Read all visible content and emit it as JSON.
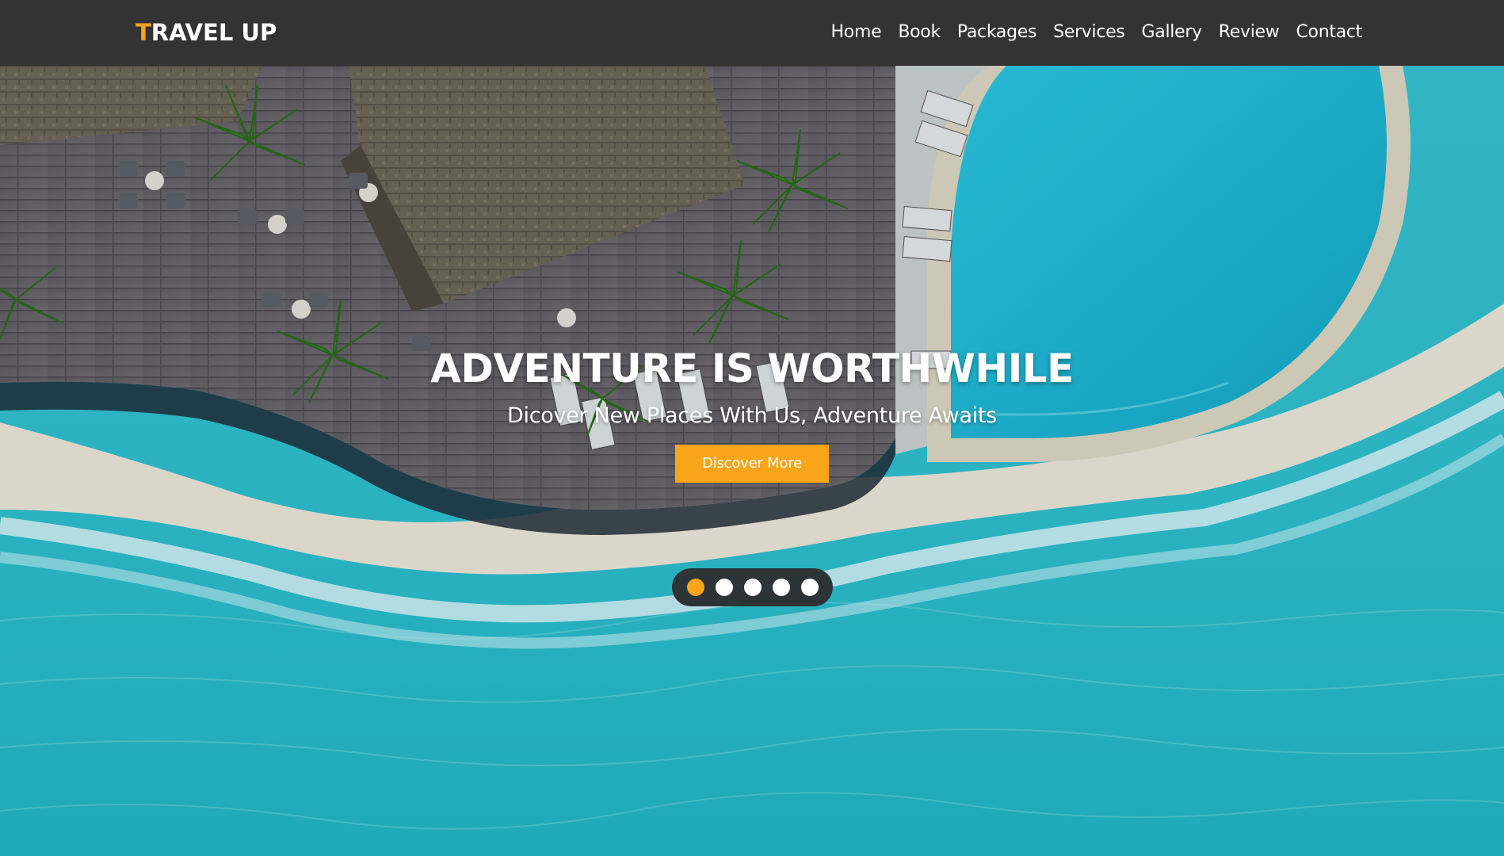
{
  "brand": {
    "first_letter": "T",
    "rest": "RAVEL UP"
  },
  "nav": {
    "items": [
      {
        "label": "Home"
      },
      {
        "label": "Book"
      },
      {
        "label": "Packages"
      },
      {
        "label": "Services"
      },
      {
        "label": "Gallery"
      },
      {
        "label": "Review"
      },
      {
        "label": "Contact"
      }
    ]
  },
  "hero": {
    "title": "ADVENTURE IS WORTHWHILE",
    "subtitle": "Dicover New Places With Us, Adventure Awaits",
    "button_label": "Discover More"
  },
  "slider": {
    "dot_count": 5,
    "active_index": 0
  },
  "colors": {
    "accent": "#f9a51a",
    "header_bg": "#333333",
    "dots_bg": "#2d3438"
  }
}
